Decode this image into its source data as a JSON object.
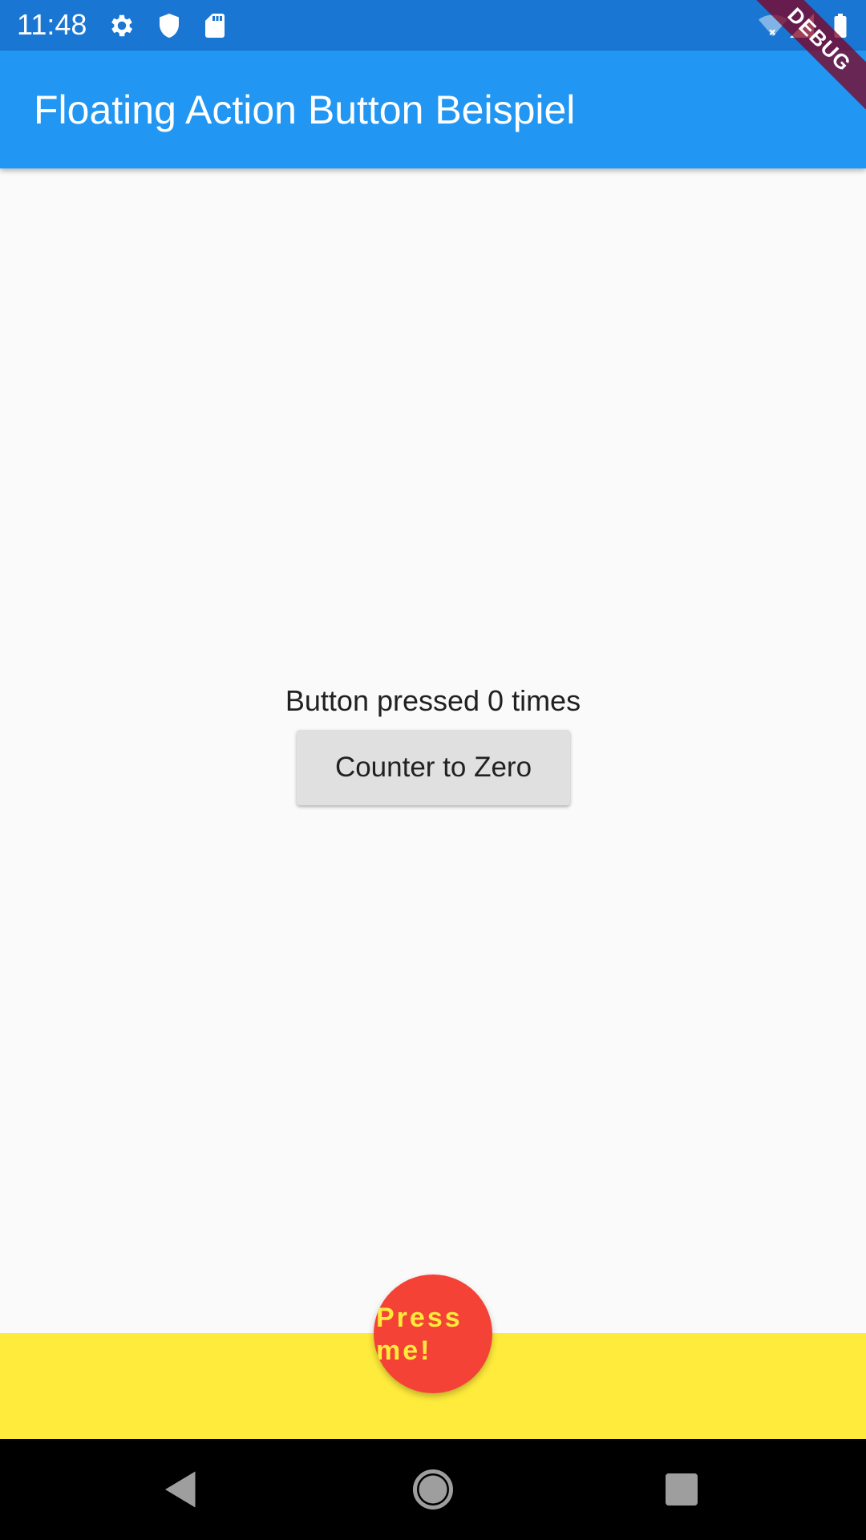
{
  "status_bar": {
    "time": "11:48",
    "icons": [
      "settings-icon",
      "shield-icon",
      "sd-card-icon",
      "wifi-off-icon",
      "signal-icon",
      "battery-icon"
    ]
  },
  "app_bar": {
    "title": "Floating Action Button Beispiel"
  },
  "debug_banner": {
    "label": "DEBUG"
  },
  "main": {
    "counter_text": "Button pressed 0 times",
    "reset_button_label": "Counter to Zero"
  },
  "fab": {
    "label": "Press me!"
  },
  "nav_bar": {
    "icons": [
      "back-icon",
      "home-icon",
      "recents-icon"
    ]
  },
  "colors": {
    "status_bar": "#1976D2",
    "app_bar": "#2196F3",
    "background": "#FAFAFA",
    "bottom_bar": "#FFEB3B",
    "fab": "#F44336",
    "fab_text": "#FFEB3B",
    "button": "#E0E0E0",
    "nav_bar": "#000000"
  }
}
